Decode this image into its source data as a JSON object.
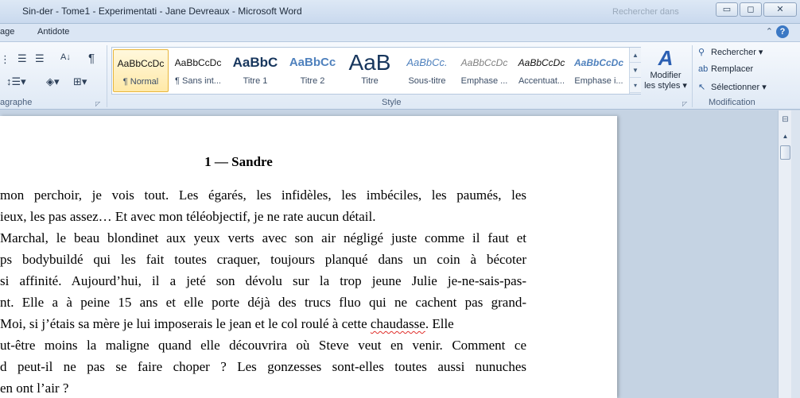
{
  "window": {
    "title": "Sin-der - Tome1 - Experimentati - Jane Devreaux  -  Microsoft Word",
    "faded_text": "Rechercher dans",
    "minimize": "▭",
    "restore": "◻",
    "close": "✕"
  },
  "tabs": {
    "page_partial": "age",
    "antidote": "Antidote",
    "collapse_icon": "⌃",
    "help_icon": "?"
  },
  "ribbon": {
    "paragraph_group_label": "agraphe",
    "style_group_label": "Style",
    "modification_group_label": "Modification",
    "pilcrow": "¶",
    "sort": "A↓",
    "styles": [
      {
        "preview": "AaBbCcDc",
        "name": "¶ Normal"
      },
      {
        "preview": "AaBbCcDc",
        "name": "¶ Sans int..."
      },
      {
        "preview": "AaBbC",
        "name": "Titre 1"
      },
      {
        "preview": "AaBbCc",
        "name": "Titre 2"
      },
      {
        "preview": "AaB",
        "name": "Titre"
      },
      {
        "preview": "AaBbCc.",
        "name": "Sous-titre"
      },
      {
        "preview": "AaBbCcDc",
        "name": "Emphase ..."
      },
      {
        "preview": "AaBbCcDc",
        "name": "Accentuat..."
      },
      {
        "preview": "AaBbCcDc",
        "name": "Emphase i..."
      }
    ],
    "modifier_line1": "Modifier",
    "modifier_line2": "les styles ▾",
    "rechercher": "Rechercher ▾",
    "remplacer": "Remplacer",
    "selectionner": "Sélectionner ▾"
  },
  "document": {
    "heading": "1 — Sandre",
    "lines": [
      "mon perchoir, je vois tout. Les égarés, les infidèles, les imbéciles, les paumés, les",
      "ieux, les pas assez… Et avec mon téléobjectif, je ne rate aucun détail.",
      "Marchal, le beau blondinet aux yeux verts avec son air négligé juste comme il faut et",
      "ps bodybuildé qui les fait toutes craquer, toujours planqué dans un coin à bécoter",
      " si affinité. Aujourd’hui, il a jeté son dévolu sur la trop jeune Julie je-ne-sais-pas-",
      "nt. Elle a à peine 15 ans et elle porte déjà des trucs fluo qui ne cachent pas grand-",
      "Moi, si j’étais sa mère je lui imposerais le jean et le col roulé à cette ",
      "ut-être moins la maligne quand elle découvrira où Steve veut en venir. Comment ce",
      "d peut-il ne pas se faire choper ? Les gonzesses sont-elles toutes aussi nunuches",
      " en ont l’air ?"
    ],
    "spell_word": "chaudasse",
    "after_spell": ". Elle"
  }
}
